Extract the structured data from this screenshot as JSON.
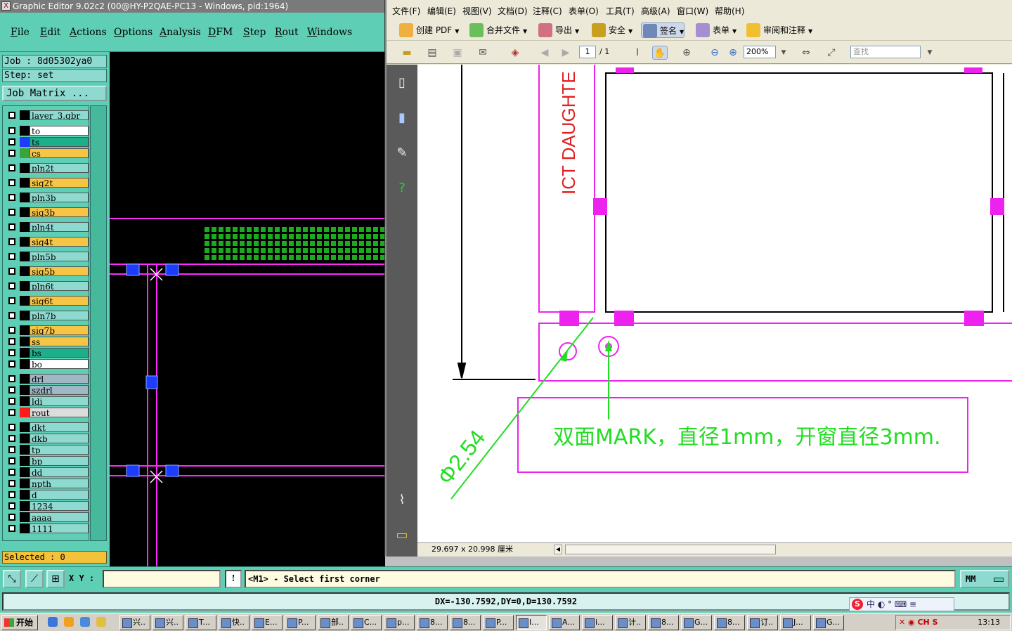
{
  "genesis": {
    "title": "Graphic Editor 9.02c2 (00@HY-P2QAE-PC13 - Windows, pid:1964)",
    "menu": [
      "File",
      "Edit",
      "Actions",
      "Options",
      "Analysis",
      "DFM",
      "Step",
      "Rout",
      "Windows"
    ],
    "job": "Job : 8d05302ya0",
    "step": "Step: set",
    "job_matrix": "Job Matrix ...",
    "layers": [
      {
        "name": "layer_3.gbr",
        "color": "#000000",
        "bg": "#8ed9d0"
      },
      {
        "name": "to",
        "color": "#000000",
        "bg": "#ffffff"
      },
      {
        "name": "ts",
        "color": "#1e3cff",
        "bg": "#1bb08a"
      },
      {
        "name": "cs",
        "color": "#3aa33a",
        "bg": "#f7c545"
      },
      {
        "name": "pln2t",
        "color": "#000000",
        "bg": "#8ed9d0"
      },
      {
        "name": "sig2t",
        "color": "#000000",
        "bg": "#f7c545"
      },
      {
        "name": "pln3b",
        "color": "#000000",
        "bg": "#8ed9d0"
      },
      {
        "name": "sig3b",
        "color": "#000000",
        "bg": "#f7c545"
      },
      {
        "name": "pln4t",
        "color": "#000000",
        "bg": "#8ed9d0"
      },
      {
        "name": "sig4t",
        "color": "#000000",
        "bg": "#f7c545"
      },
      {
        "name": "pln5b",
        "color": "#000000",
        "bg": "#8ed9d0"
      },
      {
        "name": "sig5b",
        "color": "#000000",
        "bg": "#f7c545"
      },
      {
        "name": "pln6t",
        "color": "#000000",
        "bg": "#8ed9d0"
      },
      {
        "name": "sig6t",
        "color": "#000000",
        "bg": "#f7c545"
      },
      {
        "name": "pln7b",
        "color": "#000000",
        "bg": "#8ed9d0"
      },
      {
        "name": "sig7b",
        "color": "#000000",
        "bg": "#f7c545"
      },
      {
        "name": "ss",
        "color": "#000000",
        "bg": "#f7c545"
      },
      {
        "name": "bs",
        "color": "#000000",
        "bg": "#1bb08a"
      },
      {
        "name": "bo",
        "color": "#000000",
        "bg": "#ffffff"
      },
      {
        "name": "drl",
        "color": "#000000",
        "bg": "#9fb8c4"
      },
      {
        "name": "szdrl",
        "color": "#000000",
        "bg": "#9fb8c4"
      },
      {
        "name": "ldi",
        "color": "#000000",
        "bg": "#8ed9d0"
      },
      {
        "name": "rout",
        "color": "#ff1a1a",
        "bg": "#dcdcdc"
      },
      {
        "name": "dkt",
        "color": "#000000",
        "bg": "#8ed9d0"
      },
      {
        "name": "dkb",
        "color": "#000000",
        "bg": "#8ed9d0"
      },
      {
        "name": "tp",
        "color": "#000000",
        "bg": "#8ed9d0"
      },
      {
        "name": "bp",
        "color": "#000000",
        "bg": "#8ed9d0"
      },
      {
        "name": "dd",
        "color": "#000000",
        "bg": "#8ed9d0"
      },
      {
        "name": "npth",
        "color": "#000000",
        "bg": "#8ed9d0"
      },
      {
        "name": "d",
        "color": "#000000",
        "bg": "#8ed9d0"
      },
      {
        "name": "1234",
        "color": "#000000",
        "bg": "#8ed9d0"
      },
      {
        "name": "aaaa",
        "color": "#000000",
        "bg": "#8ed9d0"
      },
      {
        "name": "1111",
        "color": "#000000",
        "bg": "#8ed9d0"
      }
    ],
    "selected": "Selected : 0",
    "xy_label": "X Y :",
    "xy_value": "",
    "prompt": "<M1> - Select first corner",
    "units": "MM",
    "measure": "DX=-130.7592,DY=0,D=130.7592",
    "colors": {
      "panel": "#5ecfb4",
      "magenta": "#ff28ff",
      "pad_blue": "#1e3cff",
      "pad_green": "#1eaa1e"
    }
  },
  "pdf": {
    "menu": [
      "文件(F)",
      "编辑(E)",
      "视图(V)",
      "文档(D)",
      "注释(C)",
      "表单(O)",
      "工具(T)",
      "高级(A)",
      "窗口(W)",
      "帮助(H)"
    ],
    "toolbar": [
      "创建 PDF",
      "合并文件",
      "导出",
      "安全",
      "签名",
      "表单",
      "审阅和注释"
    ],
    "page": "1",
    "page_total": "/ 1",
    "zoom": "200%",
    "find_placeholder": "查找",
    "doc_label_vertical": "ICT DAUGHTE",
    "dimension_text": "Φ2.54",
    "note_text": "双面MARK，直径1mm，开窗直径3mm.",
    "page_size": "29.697 x 20.998 厘米",
    "colors": {
      "magenta": "#ee22ee",
      "green": "#22dd22",
      "red": "#e02020"
    }
  },
  "taskbar": {
    "start": "开始",
    "items": [
      "兴..",
      "兴..",
      "T...",
      "快..",
      "E...",
      "P...",
      "部..",
      "C...",
      "p...",
      "8...",
      "8...",
      "P...",
      "I...",
      "A...",
      "i...",
      "计..",
      "8...",
      "G...",
      "8...",
      "订..",
      "J...",
      "G..."
    ],
    "active_index": 12,
    "time": "13:13",
    "ime": "中 ◐ ° ⌨ ≡"
  }
}
